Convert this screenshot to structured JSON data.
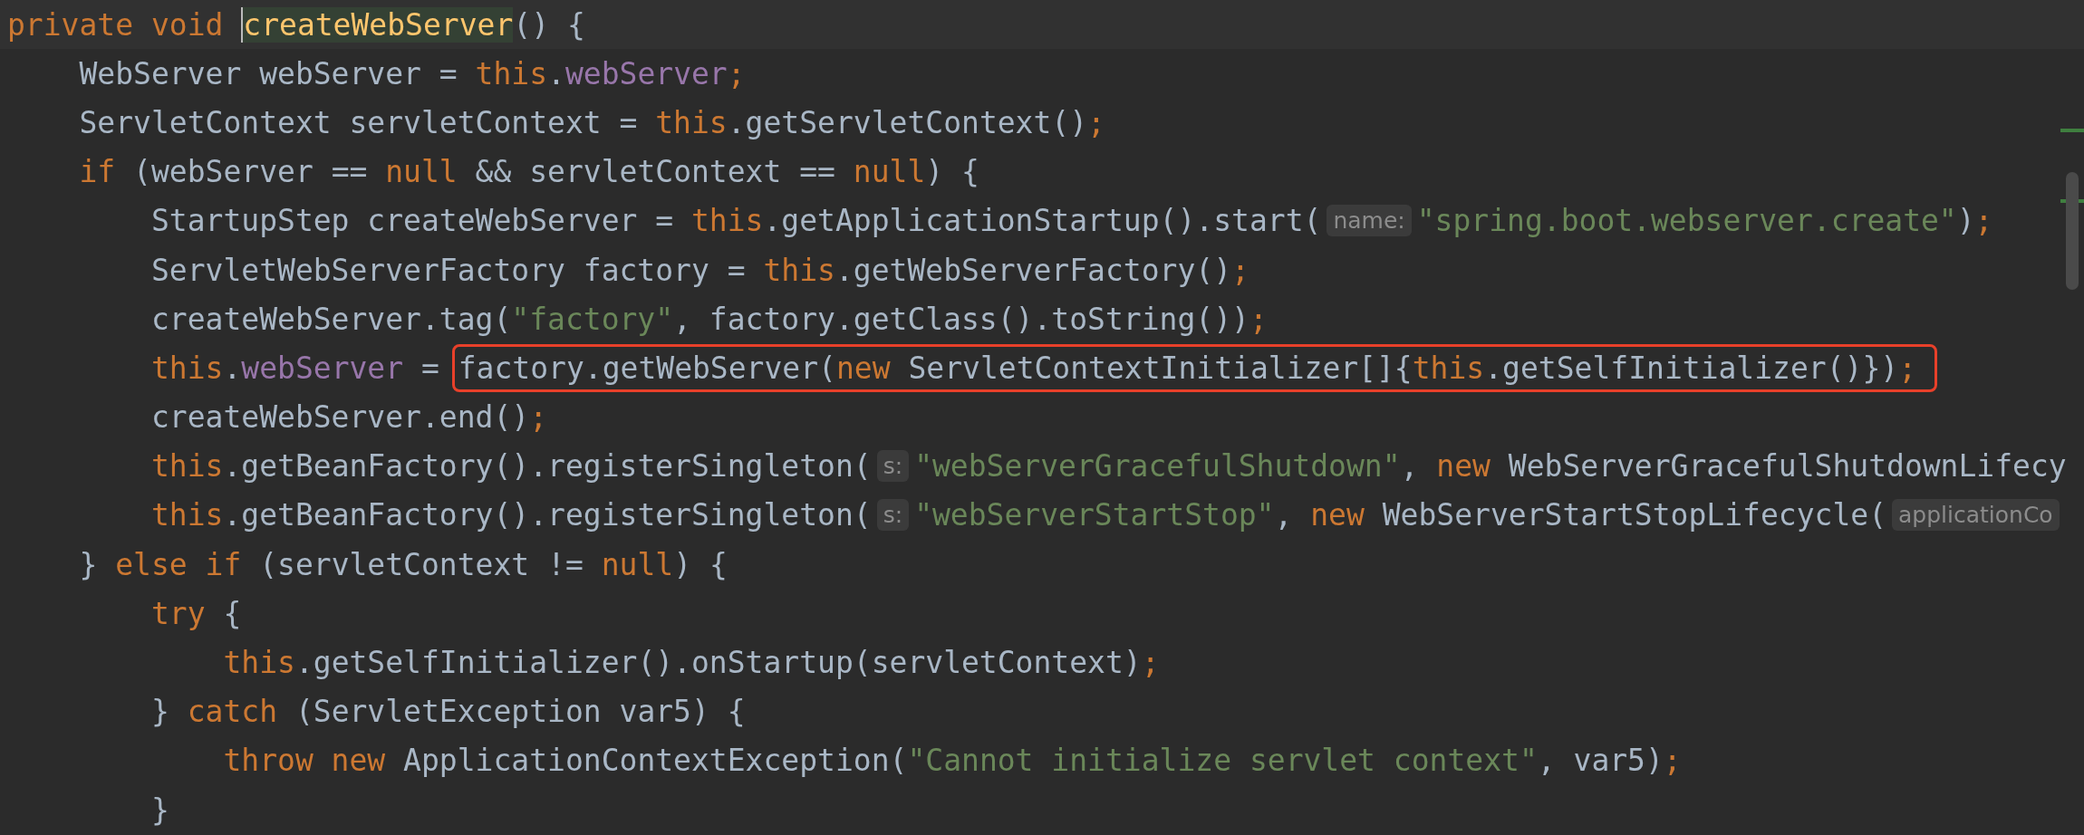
{
  "editor": {
    "lines": [
      {
        "tokens": [
          {
            "kind": "keyword",
            "text": "private void "
          },
          {
            "kind": "declaration",
            "text": "createWebServer"
          },
          {
            "kind": "plain",
            "text": "() {"
          }
        ]
      },
      {
        "tokens": [
          {
            "kind": "plain",
            "text": "    WebServer webServer = "
          },
          {
            "kind": "keyword",
            "text": "this"
          },
          {
            "kind": "plain",
            "text": "."
          },
          {
            "kind": "field",
            "text": "webServer"
          },
          {
            "kind": "keyword",
            "text": ";"
          }
        ]
      },
      {
        "tokens": [
          {
            "kind": "plain",
            "text": "    ServletContext servletContext = "
          },
          {
            "kind": "keyword",
            "text": "this"
          },
          {
            "kind": "plain",
            "text": ".getServletContext()"
          },
          {
            "kind": "keyword",
            "text": ";"
          }
        ]
      },
      {
        "tokens": [
          {
            "kind": "keyword",
            "text": "    if"
          },
          {
            "kind": "plain",
            "text": " (webServer == "
          },
          {
            "kind": "keyword",
            "text": "null"
          },
          {
            "kind": "plain",
            "text": " && servletContext == "
          },
          {
            "kind": "keyword",
            "text": "null"
          },
          {
            "kind": "plain",
            "text": ") {"
          }
        ]
      },
      {
        "tokens": [
          {
            "kind": "plain",
            "text": "        StartupStep createWebServer = "
          },
          {
            "kind": "keyword",
            "text": "this"
          },
          {
            "kind": "plain",
            "text": ".getApplicationStartup().start("
          },
          {
            "kind": "hint",
            "text": "name:"
          },
          {
            "kind": "string",
            "text": "\"spring.boot.webserver.create\""
          },
          {
            "kind": "plain",
            "text": ")"
          },
          {
            "kind": "keyword",
            "text": ";"
          }
        ]
      },
      {
        "tokens": [
          {
            "kind": "plain",
            "text": "        ServletWebServerFactory factory = "
          },
          {
            "kind": "keyword",
            "text": "this"
          },
          {
            "kind": "plain",
            "text": ".getWebServerFactory()"
          },
          {
            "kind": "keyword",
            "text": ";"
          }
        ]
      },
      {
        "tokens": [
          {
            "kind": "plain",
            "text": "        createWebServer.tag("
          },
          {
            "kind": "string",
            "text": "\"factory\""
          },
          {
            "kind": "plain",
            "text": ", factory.getClass().toString())"
          },
          {
            "kind": "keyword",
            "text": ";"
          }
        ]
      },
      {
        "tokens": [
          {
            "kind": "keyword",
            "text": "        this"
          },
          {
            "kind": "plain",
            "text": "."
          },
          {
            "kind": "field",
            "text": "webServer"
          },
          {
            "kind": "plain",
            "text": " = "
          }
        ],
        "callout": [
          {
            "kind": "plain",
            "text": "factory.getWebServer("
          },
          {
            "kind": "keyword",
            "text": "new"
          },
          {
            "kind": "plain",
            "text": " ServletContextInitializer[]{"
          },
          {
            "kind": "keyword",
            "text": "this"
          },
          {
            "kind": "plain",
            "text": ".getSelfInitializer()})"
          },
          {
            "kind": "keyword",
            "text": ";"
          }
        ]
      },
      {
        "tokens": [
          {
            "kind": "plain",
            "text": "        createWebServer.end()"
          },
          {
            "kind": "keyword",
            "text": ";"
          }
        ]
      },
      {
        "tokens": [
          {
            "kind": "keyword",
            "text": "        this"
          },
          {
            "kind": "plain",
            "text": ".getBeanFactory().registerSingleton("
          },
          {
            "kind": "hint",
            "text": "s:"
          },
          {
            "kind": "string",
            "text": "\"webServerGracefulShutdown\""
          },
          {
            "kind": "plain",
            "text": ", "
          },
          {
            "kind": "keyword",
            "text": "new"
          },
          {
            "kind": "plain",
            "text": " WebServerGracefulShutdownLifecy"
          }
        ]
      },
      {
        "tokens": [
          {
            "kind": "keyword",
            "text": "        this"
          },
          {
            "kind": "plain",
            "text": ".getBeanFactory().registerSingleton("
          },
          {
            "kind": "hint",
            "text": "s:"
          },
          {
            "kind": "string",
            "text": "\"webServerStartStop\""
          },
          {
            "kind": "plain",
            "text": ", "
          },
          {
            "kind": "keyword",
            "text": "new"
          },
          {
            "kind": "plain",
            "text": " WebServerStartStopLifecycle("
          },
          {
            "kind": "hint",
            "text": "applicationCo"
          }
        ]
      },
      {
        "tokens": [
          {
            "kind": "plain",
            "text": "    } "
          },
          {
            "kind": "keyword",
            "text": "else if"
          },
          {
            "kind": "plain",
            "text": " (servletContext != "
          },
          {
            "kind": "keyword",
            "text": "null"
          },
          {
            "kind": "plain",
            "text": ") {"
          }
        ]
      },
      {
        "tokens": [
          {
            "kind": "keyword",
            "text": "        try"
          },
          {
            "kind": "plain",
            "text": " {"
          }
        ]
      },
      {
        "tokens": [
          {
            "kind": "keyword",
            "text": "            this"
          },
          {
            "kind": "plain",
            "text": ".getSelfInitializer().onStartup(servletContext)"
          },
          {
            "kind": "keyword",
            "text": ";"
          }
        ]
      },
      {
        "tokens": [
          {
            "kind": "plain",
            "text": "        } "
          },
          {
            "kind": "keyword",
            "text": "catch"
          },
          {
            "kind": "plain",
            "text": " (ServletException var5) {"
          }
        ]
      },
      {
        "tokens": [
          {
            "kind": "keyword",
            "text": "            throw new"
          },
          {
            "kind": "plain",
            "text": " ApplicationContextException("
          },
          {
            "kind": "string",
            "text": "\"Cannot initialize servlet context\""
          },
          {
            "kind": "plain",
            "text": ", var5)"
          },
          {
            "kind": "keyword",
            "text": ";"
          }
        ]
      },
      {
        "tokens": [
          {
            "kind": "plain",
            "text": "        }"
          }
        ]
      }
    ]
  }
}
